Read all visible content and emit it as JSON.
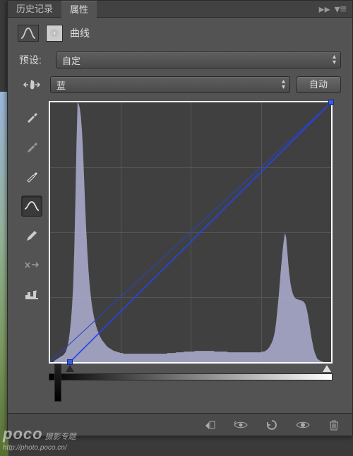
{
  "tabs": {
    "history": "历史记录",
    "properties": "属性"
  },
  "header": {
    "title": "曲线"
  },
  "preset": {
    "label": "预设:",
    "value": "自定"
  },
  "channel": {
    "value": "蓝"
  },
  "auto_button": "自动",
  "tools": {
    "eyedropper_black": "black-point",
    "eyedropper_gray": "gray-point",
    "eyedropper_white": "white-point",
    "curve": "curve-draw",
    "pencil": "pencil",
    "smooth": "smooth",
    "hist": "histogram-toggle"
  },
  "footer_icons": [
    "clip-icon",
    "view-prev-icon",
    "reset-icon",
    "visibility-icon",
    "trash-icon"
  ],
  "watermark": {
    "brand": "poco",
    "text": "摄影专题",
    "url": "http://photo.poco.cn/"
  },
  "chart_data": {
    "type": "curve",
    "title": "",
    "xlabel": "",
    "ylabel": "",
    "xlim": [
      0,
      255
    ],
    "ylim": [
      0,
      255
    ],
    "grid": [
      64,
      128,
      192
    ],
    "curve_points": [
      {
        "x": 18,
        "y": 0
      },
      {
        "x": 255,
        "y": 255
      }
    ],
    "baseline": [
      {
        "x": 0,
        "y": 0
      },
      {
        "x": 255,
        "y": 255
      }
    ],
    "histogram": [
      0,
      0,
      0,
      0,
      2,
      3,
      4,
      5,
      6,
      7,
      8,
      9,
      10,
      12,
      14,
      18,
      24,
      32,
      44,
      60,
      80,
      110,
      160,
      230,
      310,
      370,
      368,
      362,
      350,
      330,
      300,
      260,
      220,
      185,
      155,
      130,
      110,
      95,
      82,
      72,
      64,
      57,
      51,
      46,
      42,
      38,
      35,
      32,
      30,
      28,
      26,
      24,
      22,
      21,
      20,
      19,
      18,
      17,
      16,
      16,
      15,
      15,
      14,
      14,
      13,
      13,
      13,
      12,
      12,
      12,
      12,
      12,
      12,
      12,
      12,
      12,
      12,
      12,
      12,
      12,
      12,
      12,
      12,
      12,
      12,
      12,
      12,
      12,
      12,
      12,
      12,
      12,
      12,
      12,
      12,
      12,
      12,
      12,
      12,
      12,
      12,
      12,
      12,
      12,
      12,
      12,
      12,
      13,
      13,
      13,
      13,
      13,
      13,
      13,
      13,
      14,
      14,
      14,
      14,
      14,
      14,
      14,
      15,
      15,
      15,
      15,
      15,
      15,
      15,
      15,
      15,
      15,
      16,
      16,
      16,
      16,
      16,
      16,
      16,
      16,
      16,
      16,
      16,
      16,
      16,
      16,
      16,
      16,
      16,
      16,
      15,
      15,
      15,
      15,
      15,
      15,
      15,
      15,
      15,
      15,
      15,
      15,
      14,
      14,
      14,
      14,
      14,
      14,
      14,
      14,
      14,
      14,
      14,
      14,
      14,
      14,
      14,
      14,
      14,
      14,
      14,
      14,
      14,
      14,
      14,
      14,
      14,
      14,
      14,
      14,
      14,
      14,
      14,
      15,
      15,
      15,
      16,
      17,
      18,
      20,
      22,
      25,
      28,
      32,
      38,
      46,
      58,
      74,
      90,
      108,
      128,
      145,
      162,
      175,
      184,
      178,
      160,
      140,
      124,
      112,
      104,
      98,
      94,
      92,
      90,
      90,
      89,
      89,
      88,
      88,
      87,
      86,
      84,
      80,
      74,
      66,
      56,
      46,
      36,
      28,
      20,
      14,
      10,
      6,
      4,
      3,
      2,
      1,
      1,
      0,
      0,
      0,
      0,
      0,
      0,
      0
    ]
  }
}
